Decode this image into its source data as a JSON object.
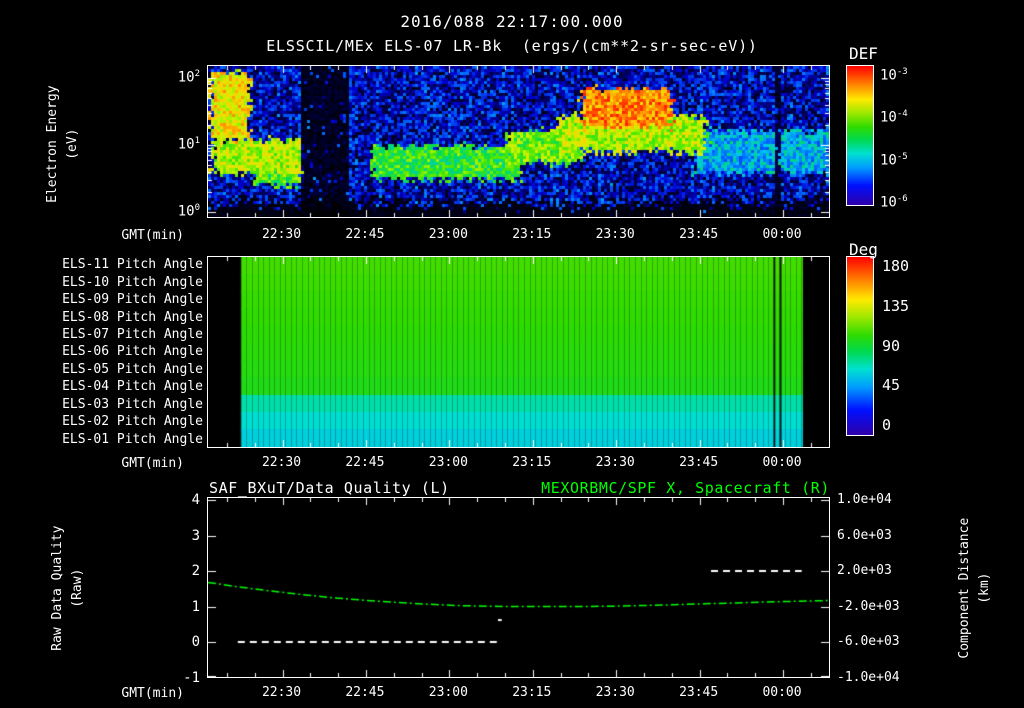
{
  "header": {
    "title": "2016/088 22:17:00.000"
  },
  "colors": {
    "background": "#000000",
    "foreground": "#ffffff",
    "accent_green": "#00ff00",
    "rainbow_stops": [
      [
        0,
        "#2f00a8"
      ],
      [
        0.14,
        "#0010ff"
      ],
      [
        0.27,
        "#009dff"
      ],
      [
        0.37,
        "#00e0d0"
      ],
      [
        0.47,
        "#00d94f"
      ],
      [
        0.56,
        "#2edb00"
      ],
      [
        0.66,
        "#9ce800"
      ],
      [
        0.76,
        "#ffe900"
      ],
      [
        0.86,
        "#ff8a00"
      ],
      [
        1,
        "#ff0000"
      ]
    ],
    "spectro_stops": [
      [
        0,
        "#000000"
      ],
      [
        0.08,
        "#000040"
      ],
      [
        0.2,
        "#0000d0"
      ],
      [
        0.32,
        "#0065ff"
      ],
      [
        0.42,
        "#00c8ee"
      ],
      [
        0.52,
        "#00d960"
      ],
      [
        0.62,
        "#4ae800"
      ],
      [
        0.72,
        "#c8f500"
      ],
      [
        0.82,
        "#ffd000"
      ],
      [
        0.91,
        "#ff7000"
      ],
      [
        1,
        "#ff1500"
      ]
    ]
  },
  "time_axis": {
    "label": "GMT(min)",
    "ticks": [
      "22:30",
      "22:45",
      "23:00",
      "23:15",
      "23:30",
      "23:45",
      "00:00"
    ],
    "tick_t": [
      0.12,
      0.2543,
      0.3887,
      0.523,
      0.6573,
      0.7917,
      0.926
    ]
  },
  "panel1": {
    "title": "ELSSCIL/MEx ELS-07 LR-Bk  (ergs/(cm**2-sr-sec-eV))",
    "ylabel_line1": "Electron Energy",
    "ylabel_line2": "(eV)",
    "ytick_exponents": [
      2,
      1,
      0
    ],
    "colorbar_label": "DEF",
    "colorbar_exponents": [
      -3,
      -4,
      -5,
      -6
    ]
  },
  "panel2": {
    "row_labels": [
      "ELS-11 Pitch Angle",
      "ELS-10 Pitch Angle",
      "ELS-09 Pitch Angle",
      "ELS-08 Pitch Angle",
      "ELS-07 Pitch Angle",
      "ELS-06 Pitch Angle",
      "ELS-05 Pitch Angle",
      "ELS-04 Pitch Angle",
      "ELS-03 Pitch Angle",
      "ELS-02 Pitch Angle",
      "ELS-01 Pitch Angle"
    ],
    "colorbar_label": "Deg",
    "colorbar_ticks": [
      "180",
      "135",
      "90",
      "45",
      "0"
    ]
  },
  "panel3": {
    "title_left": "SAF_BXuT/Data Quality (L)",
    "title_right": "MEXORBMC/SPF X, Spacecraft (R)",
    "ylabel_left_line1": "Raw Data Quality",
    "ylabel_left_line2": "(Raw)",
    "ylabel_right_line1": "Component Distance",
    "ylabel_right_line2": "(km)",
    "left_ticks": [
      "4",
      "3",
      "2",
      "1",
      "0",
      "-1"
    ],
    "right_ticks": [
      "1.0e+04",
      "6.0e+03",
      "2.0e+03",
      "-2.0e+03",
      "-6.0e+03",
      "-1.0e+04"
    ]
  },
  "chart_data": [
    {
      "type": "heatmap",
      "panel": "electron-energy-spectrogram",
      "title": "ELSSCIL/MEx ELS-07 LR-Bk",
      "units": "ergs/(cm**2-sr-sec-eV)",
      "xlabel": "GMT(min)",
      "x_ticks": [
        "22:30",
        "22:45",
        "23:00",
        "23:15",
        "23:30",
        "23:45",
        "00:00"
      ],
      "x_range": [
        "22:17",
        "00:08"
      ],
      "ylabel": "Electron Energy (eV)",
      "y_scale": "log",
      "y_range_eV": [
        1,
        200
      ],
      "colorbar": {
        "label": "DEF",
        "range": [
          1e-06,
          0.001
        ]
      },
      "background": {
        "base": 0.2,
        "noise": 0.16,
        "bottom_dark_frac": 0.1
      },
      "data_gaps_t": [
        [
          0.145,
          0.225
        ],
        [
          0.912,
          0.922
        ]
      ],
      "features": [
        {
          "t0": 0.0,
          "t1": 0.065,
          "e0": 0.52,
          "e1": 0.97,
          "v": 0.78
        },
        {
          "t0": 0.005,
          "t1": 0.15,
          "e0": 0.3,
          "e1": 0.52,
          "v": 0.7
        },
        {
          "t0": 0.07,
          "t1": 0.15,
          "e0": 0.22,
          "e1": 0.4,
          "v": 0.6
        },
        {
          "t0": 0.26,
          "t1": 0.5,
          "e0": 0.26,
          "e1": 0.48,
          "v": 0.58
        },
        {
          "t0": 0.48,
          "t1": 0.6,
          "e0": 0.36,
          "e1": 0.58,
          "v": 0.64
        },
        {
          "t0": 0.56,
          "t1": 0.8,
          "e0": 0.44,
          "e1": 0.68,
          "v": 0.7
        },
        {
          "t0": 0.6,
          "t1": 0.745,
          "e0": 0.6,
          "e1": 0.86,
          "v": 0.88
        },
        {
          "t0": 0.78,
          "t1": 1.0,
          "e0": 0.3,
          "e1": 0.58,
          "v": 0.4
        }
      ]
    },
    {
      "type": "heatmap",
      "panel": "pitch-angle",
      "rows": [
        "ELS-11",
        "ELS-10",
        "ELS-09",
        "ELS-08",
        "ELS-07",
        "ELS-06",
        "ELS-05",
        "ELS-04",
        "ELS-03",
        "ELS-02",
        "ELS-01"
      ],
      "row_values_deg": [
        104,
        103,
        102,
        101,
        100,
        99,
        98,
        96,
        72,
        66,
        62
      ],
      "value_range_deg": [
        0,
        180
      ],
      "colorbar": {
        "label": "Deg",
        "ticks": [
          180,
          135,
          90,
          45,
          0
        ]
      },
      "data_t": [
        0.053,
        0.958
      ],
      "dark_lines_t": [
        0.912,
        0.922
      ],
      "minute_grid": true
    },
    {
      "type": "line",
      "panel": "quality-and-distance",
      "title_left": "SAF_BXuT/Data Quality (L)",
      "title_right": "MEXORBMC/SPF X, Spacecraft (R)",
      "ylim_left": [
        -1,
        4
      ],
      "ylim_right": [
        -10000,
        10000
      ],
      "series": [
        {
          "name": "SAF_BXuT/Data Quality",
          "axis": "left",
          "style": "dashed",
          "color": "#ffffff",
          "segments": [
            {
              "value": 0,
              "t0": 0.048,
              "t1": 0.465
            },
            {
              "value": 0.62,
              "t0": 0.467,
              "t1": 0.473
            },
            {
              "value": 2,
              "t0": 0.81,
              "t1": 0.956
            }
          ]
        },
        {
          "name": "MEXORBMC/SPF X Spacecraft",
          "axis": "right",
          "style": "dash-dot",
          "color": "#00ff00",
          "points_t_left": [
            [
              0,
              1.68
            ],
            [
              0.05,
              1.55
            ],
            [
              0.1,
              1.44
            ],
            [
              0.15,
              1.34
            ],
            [
              0.2,
              1.25
            ],
            [
              0.25,
              1.18
            ],
            [
              0.3,
              1.12
            ],
            [
              0.35,
              1.07
            ],
            [
              0.4,
              1.03
            ],
            [
              0.45,
              1.01
            ],
            [
              0.5,
              1.0
            ],
            [
              0.55,
              1.0
            ],
            [
              0.6,
              1.0
            ],
            [
              0.65,
              1.01
            ],
            [
              0.7,
              1.03
            ],
            [
              0.75,
              1.05
            ],
            [
              0.8,
              1.08
            ],
            [
              0.85,
              1.1
            ],
            [
              0.9,
              1.13
            ],
            [
              0.95,
              1.15
            ],
            [
              1,
              1.17
            ]
          ]
        }
      ]
    }
  ]
}
